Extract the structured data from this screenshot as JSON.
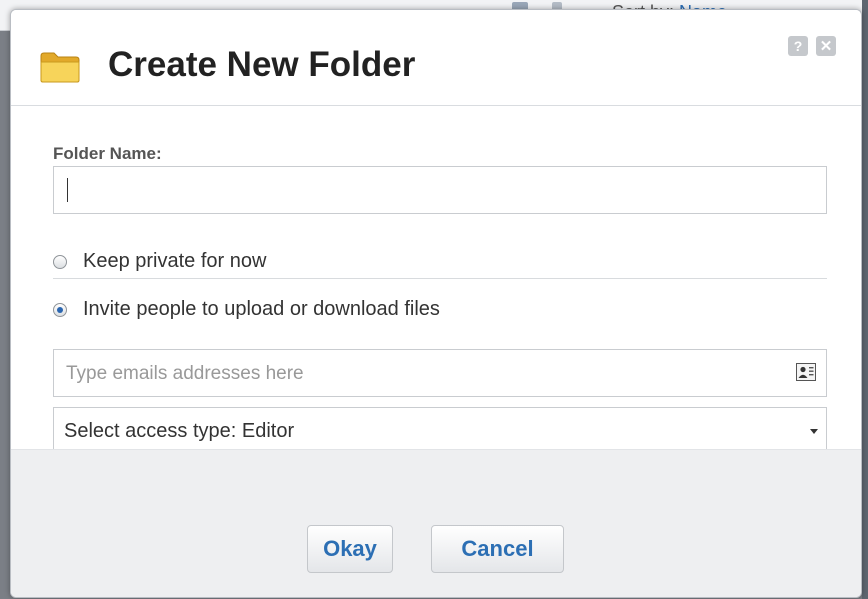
{
  "background": {
    "sort_label": "Sort by:",
    "sort_value": "Name"
  },
  "dialog": {
    "title": "Create New Folder",
    "icons": {
      "folder": "folder-icon",
      "help": "help-icon",
      "close": "close-icon"
    },
    "help_label": "?",
    "close_label": "✕"
  },
  "form": {
    "folder_name_label": "Folder Name:",
    "folder_name_value": "",
    "privacy_options": [
      {
        "label": "Keep private for now",
        "checked": false
      },
      {
        "label": "Invite people to upload or download files",
        "checked": true
      }
    ],
    "email_placeholder": "Type emails addresses here",
    "access_select_value": "Select access type: Editor"
  },
  "buttons": {
    "okay": "Okay",
    "cancel": "Cancel"
  },
  "colors": {
    "accent": "#2c6fb4",
    "folder_yellow": "#f4c640",
    "footer_bg": "#eeeff1"
  }
}
